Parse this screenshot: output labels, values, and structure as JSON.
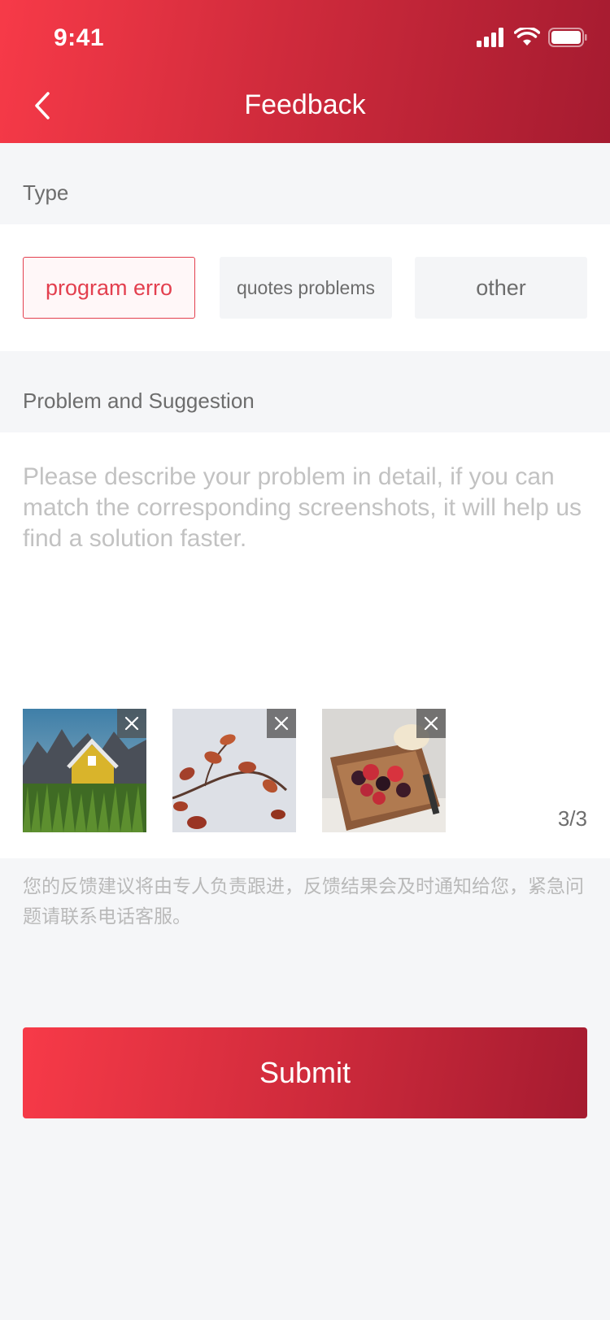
{
  "status_bar": {
    "time": "9:41"
  },
  "nav": {
    "title": "Feedback"
  },
  "type_section": {
    "label": "Type",
    "options": [
      {
        "label": "program erro",
        "selected": true
      },
      {
        "label": "quotes problems",
        "selected": false
      },
      {
        "label": "other",
        "selected": false
      }
    ]
  },
  "suggestion_section": {
    "label": "Problem and Suggestion",
    "input_value": "",
    "placeholder": "Please describe your problem in detail, if you can match the corresponding screenshots, it will help us find a solution faster.",
    "images": [
      {
        "name": "barn-in-mountains"
      },
      {
        "name": "autumn-leaves-branch"
      },
      {
        "name": "berry-dessert"
      }
    ],
    "counter": "3/3"
  },
  "notice": "您的反馈建议将由专人负责跟进，反馈结果会及时通知给您，紧急问题请联系电话客服。",
  "submit_label": "Submit",
  "colors": {
    "brand": "#e3404f",
    "gradient_start": "#f73a48",
    "gradient_end": "#a51b30"
  }
}
